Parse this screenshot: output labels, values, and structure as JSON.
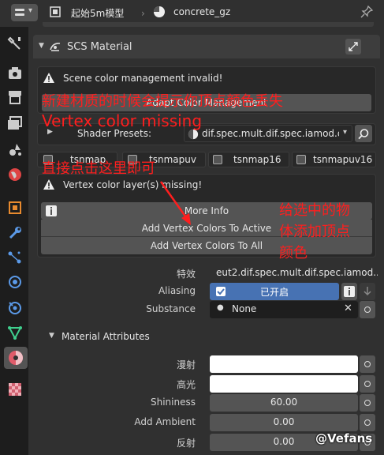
{
  "header": {
    "object_name": "起始5m模型",
    "material_name": "concrete_gz"
  },
  "panel": {
    "title": "SCS Material",
    "warning1": "Scene color management invalid!",
    "adapt_button": "Adapt Color Management",
    "shader_presets_label": "Shader Presets:",
    "shader_presets_value": "dif.spec.mult.dif.spec.iamod.dif....",
    "tabs": [
      "tsnmap",
      "tsnmapuv",
      "tsnmap16",
      "tsnmapuv16"
    ],
    "warning2": "Vertex color layer(s) missing!",
    "more_info": "More Info",
    "add_active": "Add Vertex Colors To Active",
    "add_all": "Add Vertex Colors To All",
    "effect_label": "特效",
    "effect_value": "eut2.dif.spec.mult.dif.spec.iamod....",
    "aliasing_label": "Aliasing",
    "aliasing_value": "已开启",
    "substance_label": "Substance",
    "substance_value": "None",
    "attributes_title": "Material Attributes",
    "diffuse_label": "漫射",
    "specular_label": "高光",
    "shininess_label": "Shininess",
    "shininess_value": "60.00",
    "add_ambient_label": "Add Ambient",
    "add_ambient_value": "0.00",
    "reflection_label": "反射",
    "reflection_value": "0.00"
  },
  "annotations": {
    "line1": "新建材质的时候会提示你顶点颜色丢失",
    "line2": "Vertex color missing",
    "line3": "直接点击这里即可",
    "line4a": "给选中的物",
    "line4b": "体添加顶点",
    "line4c": "颜色"
  },
  "watermark": "@Vefans",
  "colors": {
    "accent": "#4772b3",
    "annotation": "#ff1e1e",
    "tab_bar": "#1d1d1d",
    "panel_bg": "#303030"
  }
}
